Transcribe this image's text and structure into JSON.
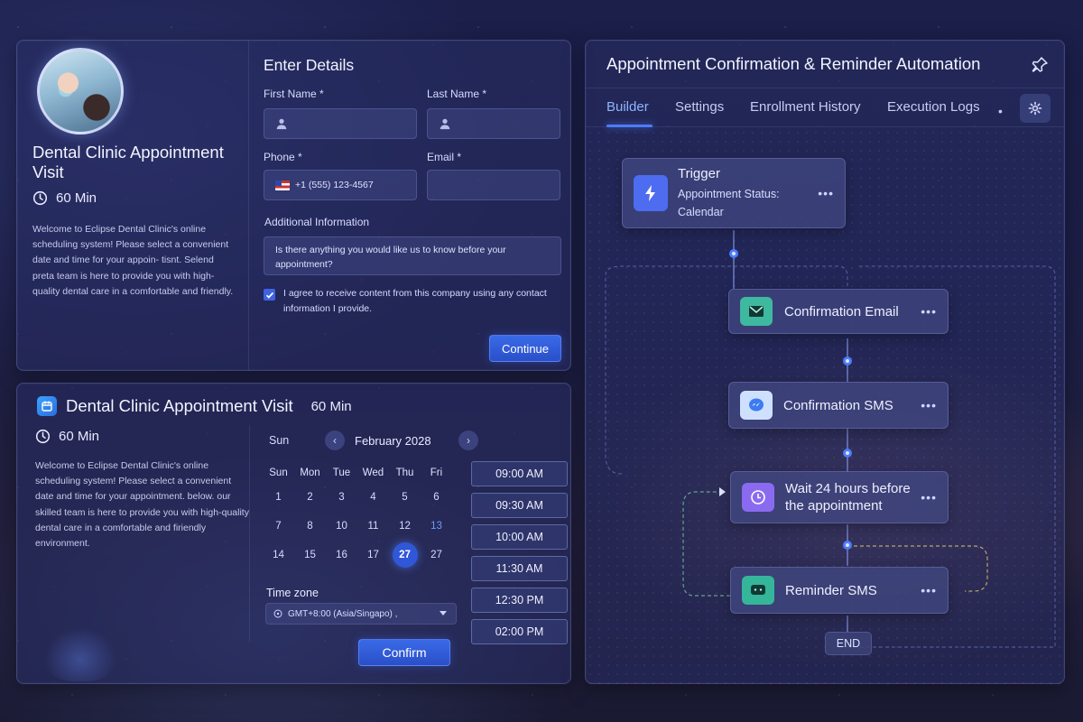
{
  "booking": {
    "title": "Dental Clinic Appointment Visit",
    "duration": "60 Min",
    "description": "Welcome to Eclipse Dental Clinic's online scheduling system! Please select a convenient date and time for your appoin- tisnt. Selend preta team is here to provide you with high-quality dental care in a comfortable and friendly.",
    "form": {
      "title": "Enter Details",
      "first_name_label": "First Name *",
      "last_name_label": "Last Name *",
      "phone_label": "Phone *",
      "phone_value": "+1 (555) 123-4567",
      "email_label": "Email *",
      "additional_label": "Additional Information",
      "additional_placeholder": "Is there anything you would like us to know before your appointment?",
      "consent_text": "I agree to receive content from this company using any contact information I provide.",
      "consent_checked": true,
      "continue_label": "Continue"
    }
  },
  "calendar": {
    "title": "Dental Clinic Appointment Visit",
    "title_duration": "60 Min",
    "duration": "60 Min",
    "description": "Welcome to Eclipse Dental Clinic's online scheduling system! Please select a convenient date and time for your appointment. below. our skilled team is here to provide you with high-quality dental care in a comfortable and firiendly environment.",
    "sun_label": "Sun",
    "month": "February 2028",
    "weekdays": [
      "Sun",
      "Mon",
      "Tue",
      "Wed",
      "Thu",
      "Fri"
    ],
    "weeks": [
      [
        "1",
        "2",
        "3",
        "4",
        "5",
        "6"
      ],
      [
        "7",
        "8",
        "10",
        "11",
        "12",
        "13"
      ],
      [
        "14",
        "15",
        "16",
        "17",
        "27",
        "27"
      ]
    ],
    "selected_day": "27",
    "timezone_label": "Time zone",
    "timezone_value": "GMT+8:00 (Asia/Singapo) ,",
    "confirm_label": "Confirm",
    "slots": [
      "09:00 AM",
      "09:30 AM",
      "10:00 AM",
      "11:30 AM",
      "12:30 PM",
      "02:00 PM"
    ]
  },
  "automation": {
    "title": "Appointment Confirmation & Reminder Automation",
    "tabs": [
      "Builder",
      "Settings",
      "Enrollment History",
      "Execution Logs"
    ],
    "active_tab": "Builder",
    "tab_more": "•",
    "nodes": {
      "trigger_title": "Trigger",
      "trigger_sub": "Appointment Status: Calendar",
      "email": "Confirmation Email",
      "sms": "Confirmation SMS",
      "wait": "Wait 24 hours before the appointment",
      "reminder": "Reminder SMS",
      "end": "END"
    },
    "more_glyph": "•••"
  },
  "colors": {
    "accent": "#3a6ae8",
    "email_icon": "#3fb8a0",
    "sms_icon": "#4a8cf0",
    "wait_icon": "#8a6bf0",
    "reminder_icon": "#35b59a",
    "trigger_icon": "#4d6cf0"
  },
  "icons": [
    "user-icon",
    "clock-icon",
    "calendar-app-icon",
    "pin-icon",
    "gear-icon",
    "lightning-icon",
    "mail-icon",
    "messenger-icon",
    "timer-icon",
    "chat-icon",
    "chevron-left-icon",
    "chevron-right-icon",
    "globe-icon",
    "check-icon"
  ]
}
